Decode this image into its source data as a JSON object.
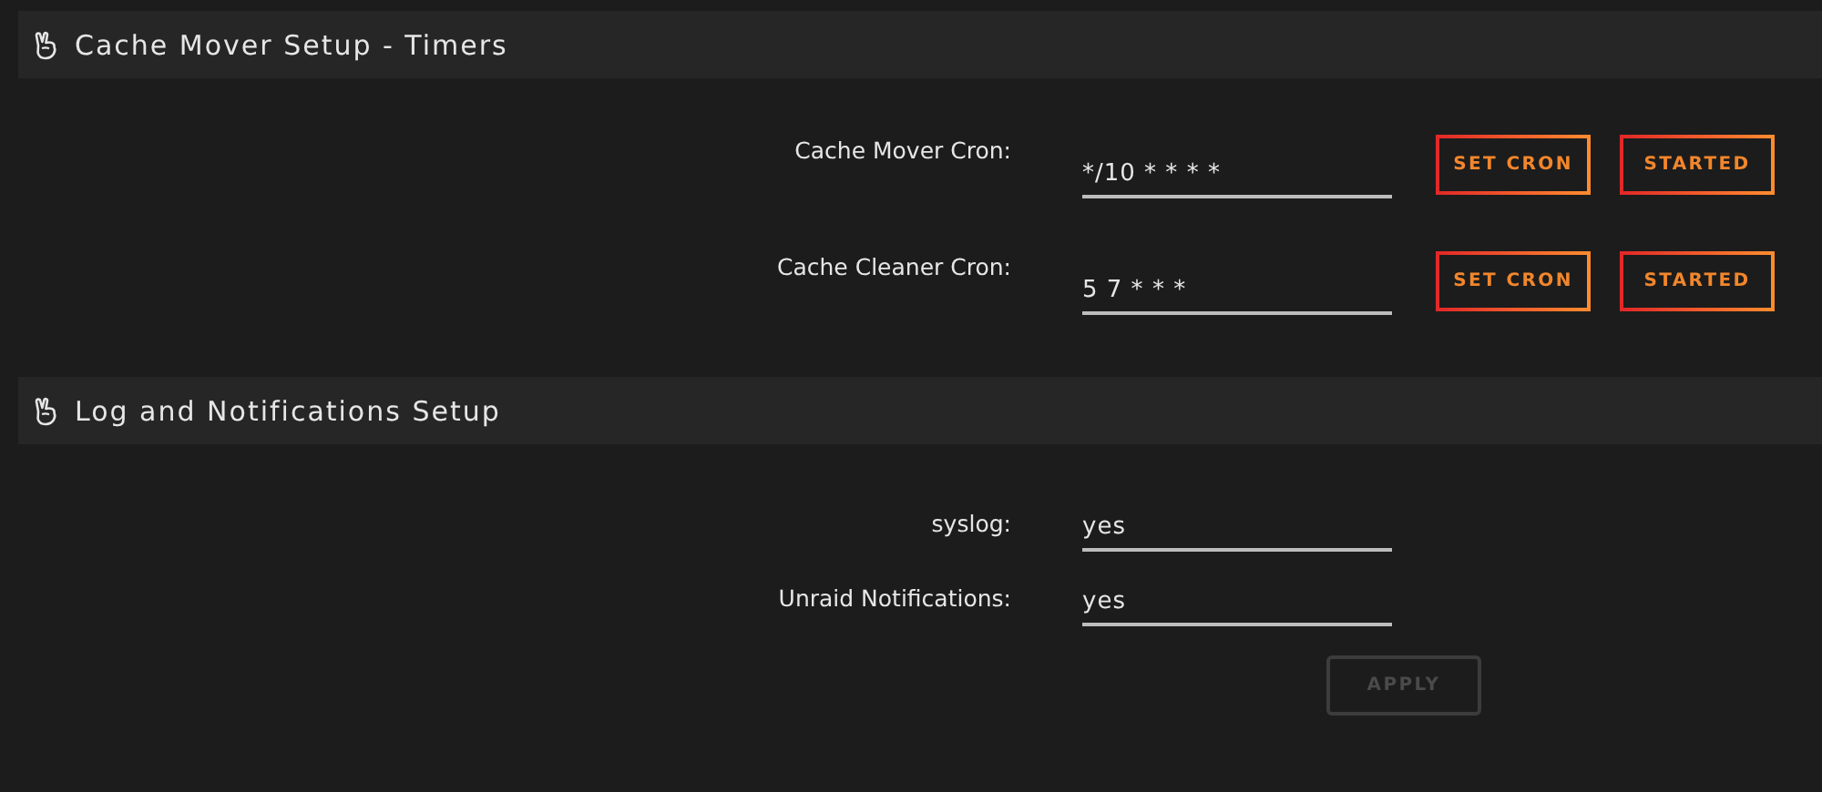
{
  "sections": [
    {
      "title": "Cache Mover Setup - Timers",
      "rows": [
        {
          "label": "Cache Mover Cron:",
          "value": "*/10 * * * *",
          "buttons": [
            {
              "label": "SET CRON",
              "disabled": false
            },
            {
              "label": "STARTED",
              "disabled": false
            }
          ]
        },
        {
          "label": "Cache Cleaner Cron:",
          "value": "5 7 * * *",
          "buttons": [
            {
              "label": "SET CRON",
              "disabled": false
            },
            {
              "label": "STARTED",
              "disabled": false
            }
          ]
        }
      ]
    },
    {
      "title": "Log and Notifications Setup",
      "rows": [
        {
          "label": "syslog:",
          "value": "yes"
        },
        {
          "label": "Unraid Notifications:",
          "value": "yes"
        }
      ],
      "footer_buttons": [
        {
          "label": "APPLY",
          "disabled": true
        }
      ]
    }
  ]
}
